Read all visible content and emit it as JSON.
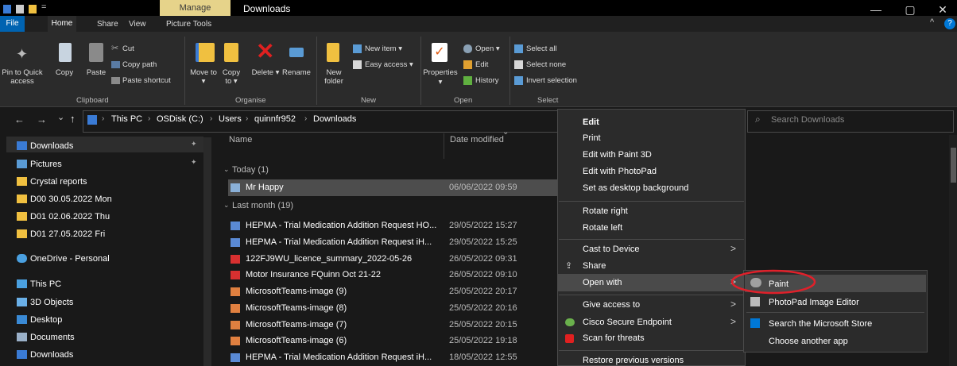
{
  "titlebar": {
    "manage_tab": "Manage",
    "title": "Downloads",
    "minimize_glyph": "—",
    "maximize_glyph": "▢",
    "close_glyph": "✕",
    "expand_glyph": "^",
    "help_glyph": "?"
  },
  "ribbon_tabs": {
    "file": "File",
    "home": "Home",
    "share": "Share",
    "view": "View",
    "picture_tools": "Picture Tools"
  },
  "ribbon": {
    "pin": "Pin to Quick access",
    "copy": "Copy",
    "paste": "Paste",
    "cut": "Cut",
    "copy_path": "Copy path",
    "paste_shortcut": "Paste shortcut",
    "clipboard_group": "Clipboard",
    "move_to": "Move to ▾",
    "copy_to": "Copy to ▾",
    "delete": "Delete ▾",
    "rename": "Rename",
    "organise_group": "Organise",
    "new_folder": "New folder",
    "new_item": "New item ▾",
    "easy_access": "Easy access ▾",
    "new_group": "New",
    "properties": "Properties",
    "properties_arrow": "▾",
    "open": "Open ▾",
    "edit": "Edit",
    "history": "History",
    "open_group": "Open",
    "select_all": "Select all",
    "select_none": "Select none",
    "invert_selection": "Invert selection",
    "select_group": "Select"
  },
  "navigation": {
    "back": "←",
    "forward": "→",
    "recent": "⌄",
    "up": "↑",
    "breadcrumb": [
      "This PC",
      "OSDisk (C:)",
      "Users",
      "quinnfr952",
      "Downloads"
    ],
    "search_placeholder": "Search Downloads",
    "search_glyph": "⌕"
  },
  "nav_pane": {
    "items": [
      "Downloads",
      "Pictures",
      "Crystal reports",
      "D00 30.05.2022 Mon",
      "D01 02.06.2022 Thu",
      "D01 27.05.2022 Fri",
      "OneDrive - Personal",
      "This PC",
      "3D Objects",
      "Desktop",
      "Documents",
      "Downloads"
    ],
    "pin_glyph": "📌"
  },
  "file_list": {
    "columns": {
      "name": "Name",
      "date": "Date modified"
    },
    "sort_glyph": "⌄",
    "group_today": "Today (1)",
    "group_last_month": "Last month (19)",
    "today": [
      {
        "name": "Mr Happy",
        "date": "06/06/2022 09:59"
      }
    ],
    "last_month": [
      {
        "name": "HEPMA - Trial Medication Addition Request HO...",
        "date": "29/05/2022 15:27"
      },
      {
        "name": "HEPMA - Trial Medication Addition Request iH...",
        "date": "29/05/2022 15:25"
      },
      {
        "name": "122FJ9WU_licence_summary_2022-05-26",
        "date": "26/05/2022 09:31"
      },
      {
        "name": "Motor Insurance FQuinn Oct 21-22",
        "date": "26/05/2022 09:10"
      },
      {
        "name": "MicrosoftTeams-image (9)",
        "date": "25/05/2022 20:17"
      },
      {
        "name": "MicrosoftTeams-image (8)",
        "date": "25/05/2022 20:16"
      },
      {
        "name": "MicrosoftTeams-image (7)",
        "date": "25/05/2022 20:15"
      },
      {
        "name": "MicrosoftTeams-image (6)",
        "date": "25/05/2022 19:18"
      },
      {
        "name": "HEPMA - Trial Medication Addition Request iH...",
        "date": "18/05/2022 12:55"
      }
    ]
  },
  "context_menu": {
    "edit": "Edit",
    "print": "Print",
    "edit_paint3d": "Edit with Paint 3D",
    "edit_photopad": "Edit with PhotoPad",
    "set_background": "Set as desktop background",
    "rotate_right": "Rotate right",
    "rotate_left": "Rotate left",
    "cast": "Cast to Device",
    "share": "Share",
    "open_with": "Open with",
    "give_access": "Give access to",
    "cisco": "Cisco Secure Endpoint",
    "scan": "Scan for threats",
    "restore": "Restore previous versions",
    "arrow": ">"
  },
  "open_with_submenu": {
    "paint": "Paint",
    "photopad": "PhotoPad Image Editor",
    "store": "Search the Microsoft Store",
    "choose": "Choose another app"
  },
  "colors": {
    "highlight_circle": "#e0202a",
    "accent": "#0063b1",
    "selection": "#4d4d4d"
  }
}
